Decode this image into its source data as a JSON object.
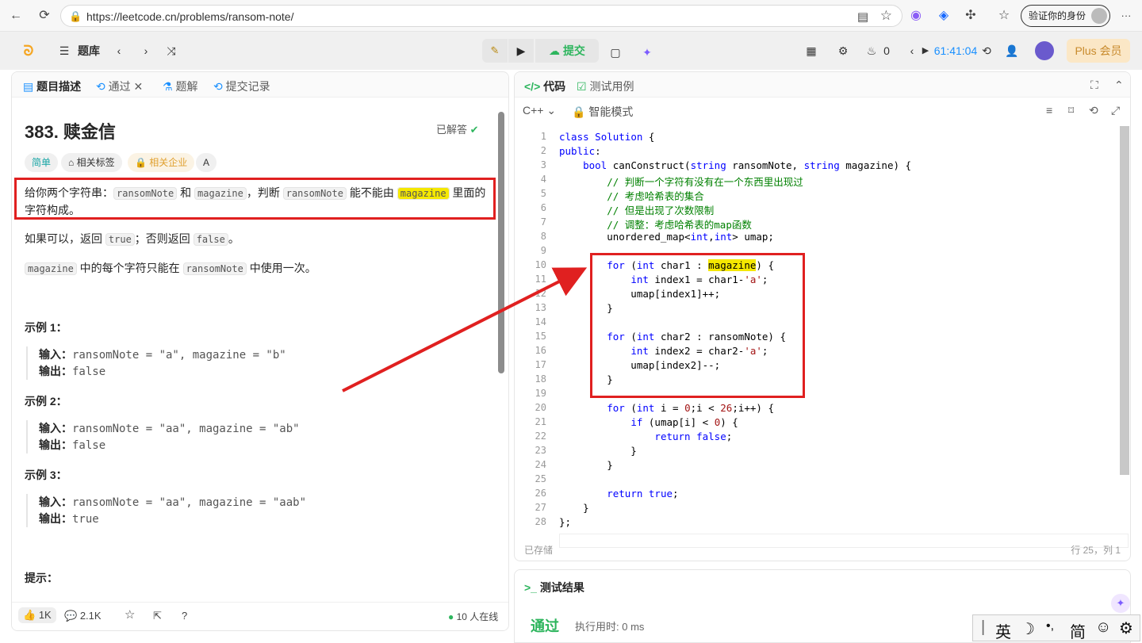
{
  "browser": {
    "url": "https://leetcode.cn/problems/ransom-note/",
    "verify_label": "验证你的身份",
    "more": "···"
  },
  "header": {
    "problem_bank": "题库",
    "submit": "提交",
    "streak": "0",
    "timer": "61:41:04",
    "plus": "Plus 会员"
  },
  "left": {
    "tabs": [
      "题目描述",
      "通过",
      "题解",
      "提交记录"
    ],
    "title": "383. 赎金信",
    "solved": "已解答",
    "tags": [
      "简单",
      "相关标签",
      "相关企业",
      "A"
    ],
    "desc": {
      "p1a": "给你两个字符串：",
      "c1": "ransomNote",
      "p1b": " 和 ",
      "c2": "magazine",
      "p1c": "，判断 ",
      "c3": "ransomNote",
      "p1d": " 能不能由 ",
      "c4": "magazine",
      "p1e": " 里面的",
      "p1f": "字符构成。"
    },
    "p2": {
      "a": "如果可以，返回 ",
      "c1": "true",
      "b": "；否则返回 ",
      "c2": "false",
      "c": "。"
    },
    "p3": {
      "c1": "magazine",
      "a": " 中的每个字符只能在 ",
      "c2": "ransomNote",
      "b": " 中使用一次。"
    },
    "examples": [
      {
        "title": "示例 1：",
        "in_label": "输入：",
        "input": "ransomNote = \"a\", magazine = \"b\"",
        "out_label": "输出：",
        "output": "false"
      },
      {
        "title": "示例 2：",
        "in_label": "输入：",
        "input": "ransomNote = \"aa\", magazine = \"ab\"",
        "out_label": "输出：",
        "output": "false"
      },
      {
        "title": "示例 3：",
        "in_label": "输入：",
        "input": "ransomNote = \"aa\", magazine = \"aab\"",
        "out_label": "输出：",
        "output": "true"
      }
    ],
    "hint": "提示：",
    "footer": {
      "likes": "1K",
      "comments": "2.1K",
      "online": "10 人在线"
    }
  },
  "right": {
    "tabs": [
      "代码",
      "测试用例"
    ],
    "lang": "C++",
    "mode": "智能模式",
    "saved": "已存储",
    "position": "行 25，列 1",
    "line_numbers": [
      "1",
      "2",
      "3",
      "4",
      "5",
      "6",
      "7",
      "8",
      "9",
      "10",
      "11",
      "12",
      "13",
      "14",
      "15",
      "16",
      "17",
      "18",
      "19",
      "20",
      "21",
      "22",
      "23",
      "24",
      "25",
      "26",
      "27",
      "28"
    ],
    "result_title": "测试结果",
    "result_status": "通过",
    "result_time": "执行用时: 0 ms"
  },
  "ime": {
    "items": [
      "英",
      "☽",
      "•,",
      "简",
      "☺",
      "⚙"
    ]
  }
}
